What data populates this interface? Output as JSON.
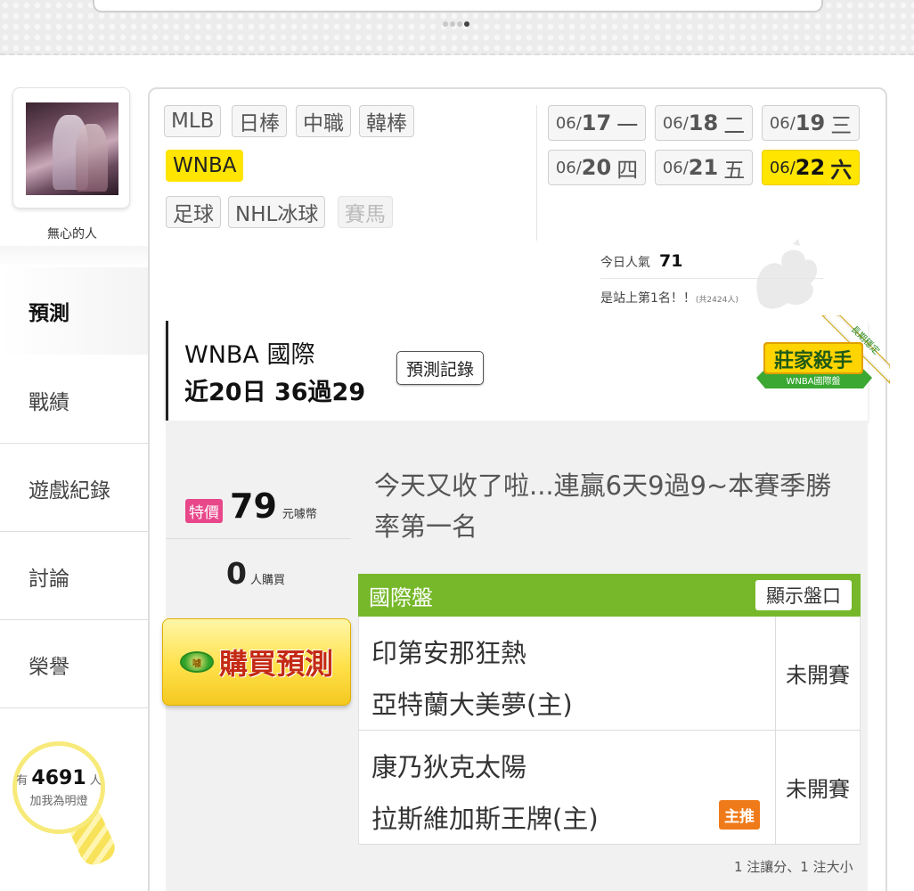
{
  "user": {
    "name": "無心的人"
  },
  "sidebar": {
    "items": [
      {
        "label": "預測",
        "active": true
      },
      {
        "label": "戰績",
        "active": false
      },
      {
        "label": "遊戲紀錄",
        "active": false
      },
      {
        "label": "討論",
        "active": false
      },
      {
        "label": "榮譽",
        "active": false
      }
    ],
    "fans": {
      "prefix": "有",
      "count": "4691",
      "suffix": "人",
      "caption": "加我為明燈"
    }
  },
  "leagues": [
    {
      "label": "MLB",
      "state": "normal"
    },
    {
      "label": "日棒",
      "state": "normal"
    },
    {
      "label": "中職",
      "state": "normal"
    },
    {
      "label": "韓棒",
      "state": "normal"
    },
    {
      "label": "WNBA",
      "state": "selected"
    },
    {
      "label": "足球",
      "state": "normal"
    },
    {
      "label": "NHL冰球",
      "state": "normal"
    },
    {
      "label": "賽馬",
      "state": "disabled"
    }
  ],
  "dates": [
    {
      "month": "06/",
      "day": "17",
      "weekday": "一",
      "selected": false
    },
    {
      "month": "06/",
      "day": "18",
      "weekday": "二",
      "selected": false
    },
    {
      "month": "06/",
      "day": "19",
      "weekday": "三",
      "selected": false
    },
    {
      "month": "06/",
      "day": "20",
      "weekday": "四",
      "selected": false
    },
    {
      "month": "06/",
      "day": "21",
      "weekday": "五",
      "selected": false
    },
    {
      "month": "06/",
      "day": "22",
      "weekday": "六",
      "selected": true
    }
  ],
  "popularity": {
    "label": "今日人氣",
    "value": "71",
    "rank_text": "是站上第1名！！",
    "total_text": "(共2424人)"
  },
  "league_header": {
    "title": "WNBA 國際",
    "record": "近20日 36過29",
    "record_button": "預測記錄",
    "badge": {
      "title": "莊家殺手",
      "subtitle": "WNBA國際盤",
      "ribbon": "長期穩定"
    }
  },
  "purchase": {
    "tag": "特價",
    "price": "79",
    "unit": "元噱幣",
    "buyers": "0",
    "buyers_unit": "人購買",
    "coin_text": "噱",
    "button": "購買預測"
  },
  "message": "今天又收了啦...連贏6天9過9~本賽季勝率第一名",
  "games": {
    "title": "國際盤",
    "show_button": "顯示盤口",
    "rows": [
      {
        "away": "印第安那狂熱",
        "home": "亞特蘭大美夢(主)",
        "status": "未開賽",
        "tag": ""
      },
      {
        "away": "康乃狄克太陽",
        "home": "拉斯維加斯王牌(主)",
        "status": "未開賽",
        "tag": "主推"
      }
    ],
    "note": "1 注讓分、1 注大小"
  },
  "colors": {
    "accent_yellow": "#ffe500",
    "table_green": "#76b82a",
    "price_pink": "#e8478a",
    "tag_orange": "#ef7a1a"
  }
}
